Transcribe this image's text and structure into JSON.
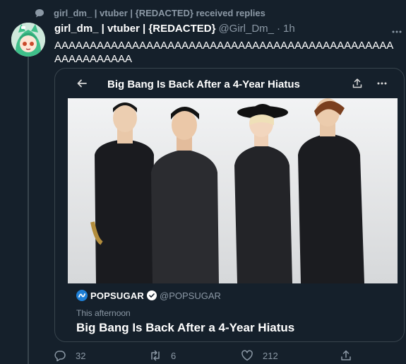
{
  "context": {
    "text": "girl_dm_ | vtuber | {REDACTED} received replies"
  },
  "tweet": {
    "display_name": "girl_dm_ | vtuber | {REDACTED}",
    "handle": "@Girl_Dm_",
    "separator": "·",
    "time": "1h",
    "text": "AAAAAAAAAAAAAAAAAAAAAAAAAAAAAAAAAAAAAAAAAAAAAAAAAAAAAAAAAAA"
  },
  "card": {
    "top_title": "Big Bang Is Back After a 4-Year Hiatus",
    "source_name": "POPSUGAR",
    "source_handle": "@POPSUGAR",
    "date": "This afternoon",
    "headline": "Big Bang Is Back After a 4-Year Hiatus"
  },
  "actions": {
    "replies": "32",
    "retweets": "6",
    "likes": "212"
  },
  "colors": {
    "background": "#15202b",
    "border": "#38444d",
    "muted": "#8b98a5",
    "text": "#ffffff",
    "verified": "#ffffff",
    "popsugar_blue": "#1e7fd6"
  },
  "icons": [
    "comment-bubble-icon",
    "back-arrow-icon",
    "share-icon",
    "more-icon",
    "reply-icon",
    "retweet-icon",
    "like-icon",
    "verified-icon",
    "popsugar-logo-icon"
  ]
}
